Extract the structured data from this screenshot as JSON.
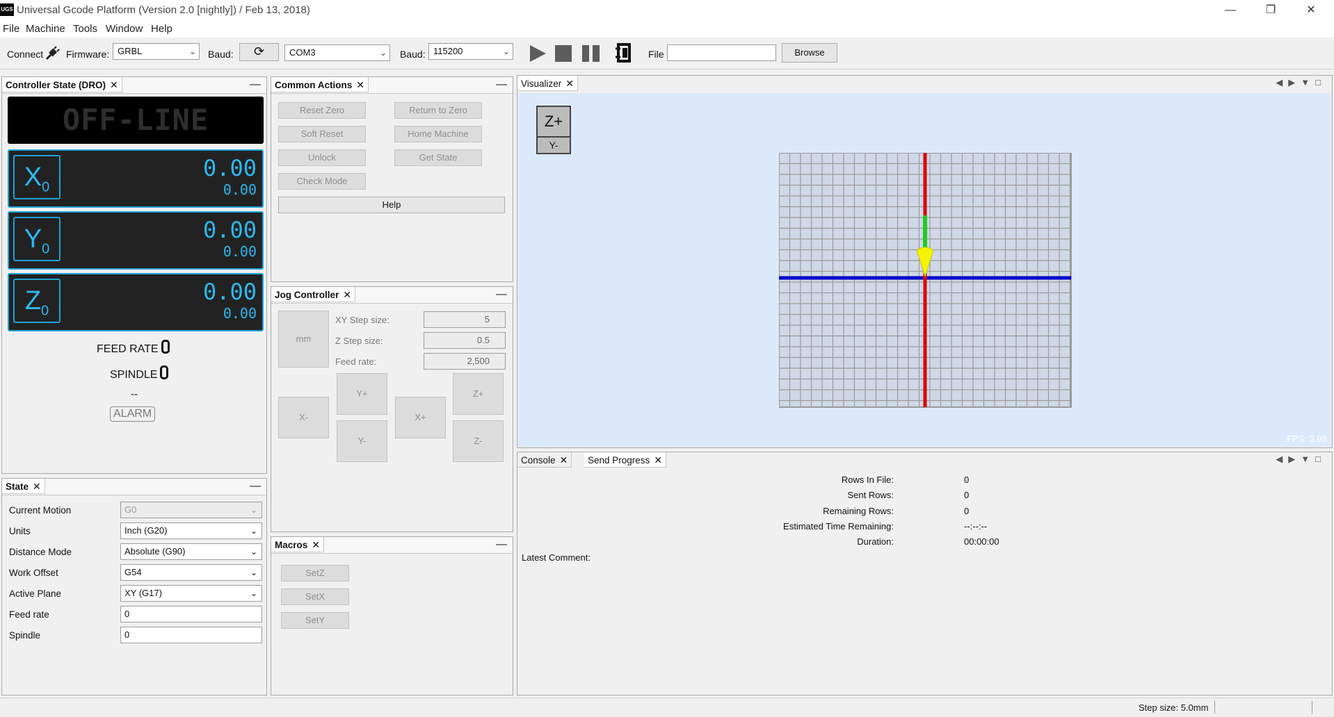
{
  "window": {
    "title": "Universal Gcode Platform (Version 2.0 [nightly])  / Feb 13, 2018)",
    "logo": "UGS",
    "min_icon": "minimize-icon",
    "max_icon": "restore-icon",
    "close_icon": "close-icon"
  },
  "menu": [
    "File",
    "Machine",
    "Tools",
    "Window",
    "Help"
  ],
  "toolbar": {
    "connect": "Connect",
    "firmware_label": "Firmware:",
    "firmware": "GRBL",
    "baud_label": "Baud:",
    "port": "COM3",
    "baud_label2": "Baud:",
    "baud": "115200",
    "file_label": "File",
    "file_value": "",
    "browse": "Browse"
  },
  "dro": {
    "title": "Controller State (DRO)",
    "status": "OFF-LINE",
    "axes": [
      {
        "name": "X",
        "sub": "0",
        "work": "0.00",
        "machine": "0.00"
      },
      {
        "name": "Y",
        "sub": "0",
        "work": "0.00",
        "machine": "0.00"
      },
      {
        "name": "Z",
        "sub": "0",
        "work": "0.00",
        "machine": "0.00"
      }
    ],
    "feed_label": "FEED RATE",
    "spindle_label": "SPINDLE",
    "pin": "--",
    "alarm": "ALARM"
  },
  "state": {
    "title": "State",
    "rows": [
      {
        "label": "Current Motion",
        "value": "G0"
      },
      {
        "label": "Units",
        "value": "Inch (G20)"
      },
      {
        "label": "Distance Mode",
        "value": "Absolute (G90)"
      },
      {
        "label": "Work Offset",
        "value": "G54"
      },
      {
        "label": "Active Plane",
        "value": "XY (G17)"
      },
      {
        "label": "Feed rate",
        "value": "0"
      },
      {
        "label": "Spindle",
        "value": "0"
      }
    ]
  },
  "actions": {
    "title": "Common Actions",
    "buttons": [
      "Reset Zero",
      "Return to Zero",
      "Soft Reset",
      "Home Machine",
      "Unlock",
      "Get State",
      "Check Mode"
    ],
    "help": "Help"
  },
  "jog": {
    "title": "Jog Controller",
    "unit": "mm",
    "xy_label": "XY Step size:",
    "xy": "5",
    "z_label": "Z Step size:",
    "z": "0.5",
    "feed_label": "Feed rate:",
    "feed": "2,500",
    "buttons": {
      "xm": "X-",
      "yp": "Y+",
      "ym": "Y-",
      "xp": "X+",
      "zp": "Z+",
      "zm": "Z-"
    }
  },
  "macros": {
    "title": "Macros",
    "items": [
      "SetZ",
      "SetX",
      "SetY"
    ]
  },
  "visualizer": {
    "title": "Visualizer",
    "view_top": "Z+",
    "view_bottom": "Y-",
    "fps": "FPS: 3.98"
  },
  "console": {
    "tab1": "Console",
    "tab2": "Send Progress"
  },
  "progress": {
    "rows": [
      {
        "label": "Rows In File:",
        "value": "0"
      },
      {
        "label": "Sent Rows:",
        "value": "0"
      },
      {
        "label": "Remaining Rows:",
        "value": "0"
      },
      {
        "label": "Estimated Time Remaining:",
        "value": "--:--:--"
      },
      {
        "label": "Duration:",
        "value": "00:00:00"
      }
    ],
    "latest": "Latest Comment:"
  },
  "statusbar": {
    "step": "Step size: 5.0mm"
  },
  "colors": {
    "axis_x": "#0000cc",
    "axis_y": "#dd0000",
    "axis_z": "#22cc22",
    "tool": "#f4f400",
    "dro": "#2db9ef",
    "vis_bg": "#dce9fb"
  }
}
